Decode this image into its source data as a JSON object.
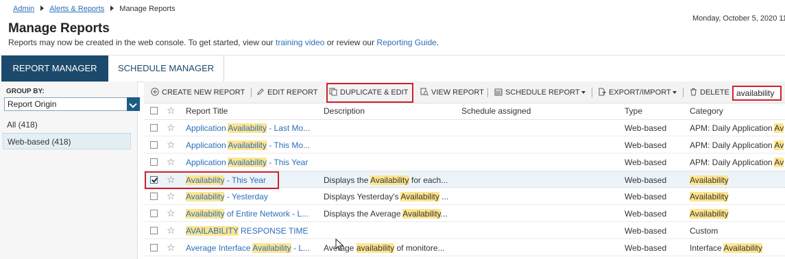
{
  "breadcrumb": {
    "item1": "Admin",
    "item2": "Alerts & Reports",
    "current": "Manage Reports"
  },
  "datetime": "Monday, October 5, 2020 11",
  "page": {
    "title": "Manage Reports",
    "subtitle_pre": "Reports may now be created in the web console. To get started, view our ",
    "subtitle_link1": "training video",
    "subtitle_mid": " or review our ",
    "subtitle_link2": "Reporting Guide",
    "subtitle_post": "."
  },
  "tabs": {
    "active": "REPORT MANAGER",
    "inactive": "SCHEDULE MANAGER"
  },
  "sidebar": {
    "group_by_label": "GROUP BY:",
    "group_by_value": "Report Origin",
    "items": [
      "All (418)",
      "Web-based (418)"
    ]
  },
  "toolbar": {
    "create": "CREATE NEW REPORT",
    "edit": "EDIT REPORT",
    "duplicate": "DUPLICATE & EDIT",
    "view": "VIEW REPORT",
    "schedule": "SCHEDULE REPORT",
    "export": "EXPORT/IMPORT",
    "delete": "DELETE",
    "search_value": "availability",
    "icons": {
      "create": "plus-circle-icon",
      "edit": "pencil-icon",
      "duplicate": "duplicate-icon",
      "view": "view-report-icon",
      "schedule": "calendar-icon",
      "export": "export-icon",
      "delete": "trash-icon"
    }
  },
  "columns": {
    "title": "Report Title",
    "description": "Description",
    "schedule": "Schedule assigned",
    "type": "Type",
    "category": "Category"
  },
  "rows": [
    {
      "title": [
        "Application ",
        "Availability",
        " - Last Mo..."
      ],
      "desc": [
        "",
        "",
        ""
      ],
      "type": "Web-based",
      "cat": [
        "APM: Daily Application ",
        "Av",
        ""
      ],
      "selected": false
    },
    {
      "title": [
        "Application ",
        "Availability",
        " - This Mo..."
      ],
      "desc": [
        "",
        "",
        ""
      ],
      "type": "Web-based",
      "cat": [
        "APM: Daily Application ",
        "Av",
        ""
      ],
      "selected": false
    },
    {
      "title": [
        "Application ",
        "Availability",
        " - This Year"
      ],
      "desc": [
        "",
        "",
        ""
      ],
      "type": "Web-based",
      "cat": [
        "APM: Daily Application ",
        "Av",
        ""
      ],
      "selected": false
    },
    {
      "title": [
        "",
        "Availability",
        " - This Year"
      ],
      "desc": [
        "Displays the ",
        "Availability",
        " for each..."
      ],
      "type": "Web-based",
      "cat": [
        "",
        "Availability",
        ""
      ],
      "selected": true
    },
    {
      "title": [
        "",
        "Availability",
        " - Yesterday"
      ],
      "desc": [
        "Displays Yesterday's ",
        "Availability",
        " ..."
      ],
      "type": "Web-based",
      "cat": [
        "",
        "Availability",
        ""
      ],
      "selected": false
    },
    {
      "title": [
        "",
        "Availability",
        " of Entire Network - L..."
      ],
      "desc": [
        "Displays the Average ",
        "Availability",
        "..."
      ],
      "type": "Web-based",
      "cat": [
        "",
        "Availability",
        ""
      ],
      "selected": false
    },
    {
      "title": [
        "",
        "AVAILABILITY",
        " RESPONSE TIME"
      ],
      "desc": [
        "",
        "",
        ""
      ],
      "type": "Web-based",
      "cat": [
        "Custom",
        "",
        ""
      ],
      "selected": false
    },
    {
      "title": [
        "Average Interface ",
        "Availability",
        " - L..."
      ],
      "desc": [
        "Average ",
        "availability",
        " of monitore..."
      ],
      "type": "Web-based",
      "cat": [
        "Interface ",
        "Availability",
        ""
      ],
      "selected": false
    }
  ],
  "colors": {
    "accent": "#1b4a6c",
    "link": "#2a6ebb",
    "highlight": "#ffe58f",
    "annotation": "#d0202a"
  }
}
